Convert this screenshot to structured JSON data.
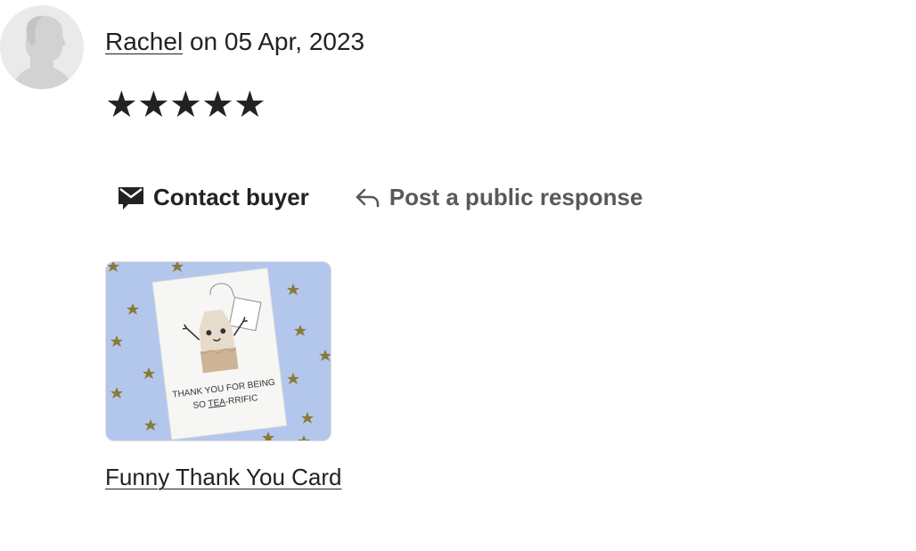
{
  "review": {
    "reviewer_name": "Rachel",
    "date_text": " on 05 Apr, 2023",
    "rating": 5,
    "rating_max": 5,
    "star_glyph": "★"
  },
  "actions": {
    "contact_label": "Contact buyer",
    "contact_icon": "envelope-icon",
    "respond_label": "Post a public response",
    "respond_icon": "reply-arrow-icon"
  },
  "listing": {
    "title": "Funny Thank You Card",
    "card_text_line1": "THANK YOU FOR BEING",
    "card_text_line2_prefix": "SO ",
    "card_text_line2_emph": "TEA",
    "card_text_line2_suffix": "-RRIFIC",
    "background_color": "#b3c6ec",
    "star_color": "#8a7a3a"
  },
  "colors": {
    "text_primary": "#222222",
    "text_secondary": "#595959",
    "avatar_bg": "#eaeaea",
    "avatar_silhouette": "#d2d2d2"
  }
}
